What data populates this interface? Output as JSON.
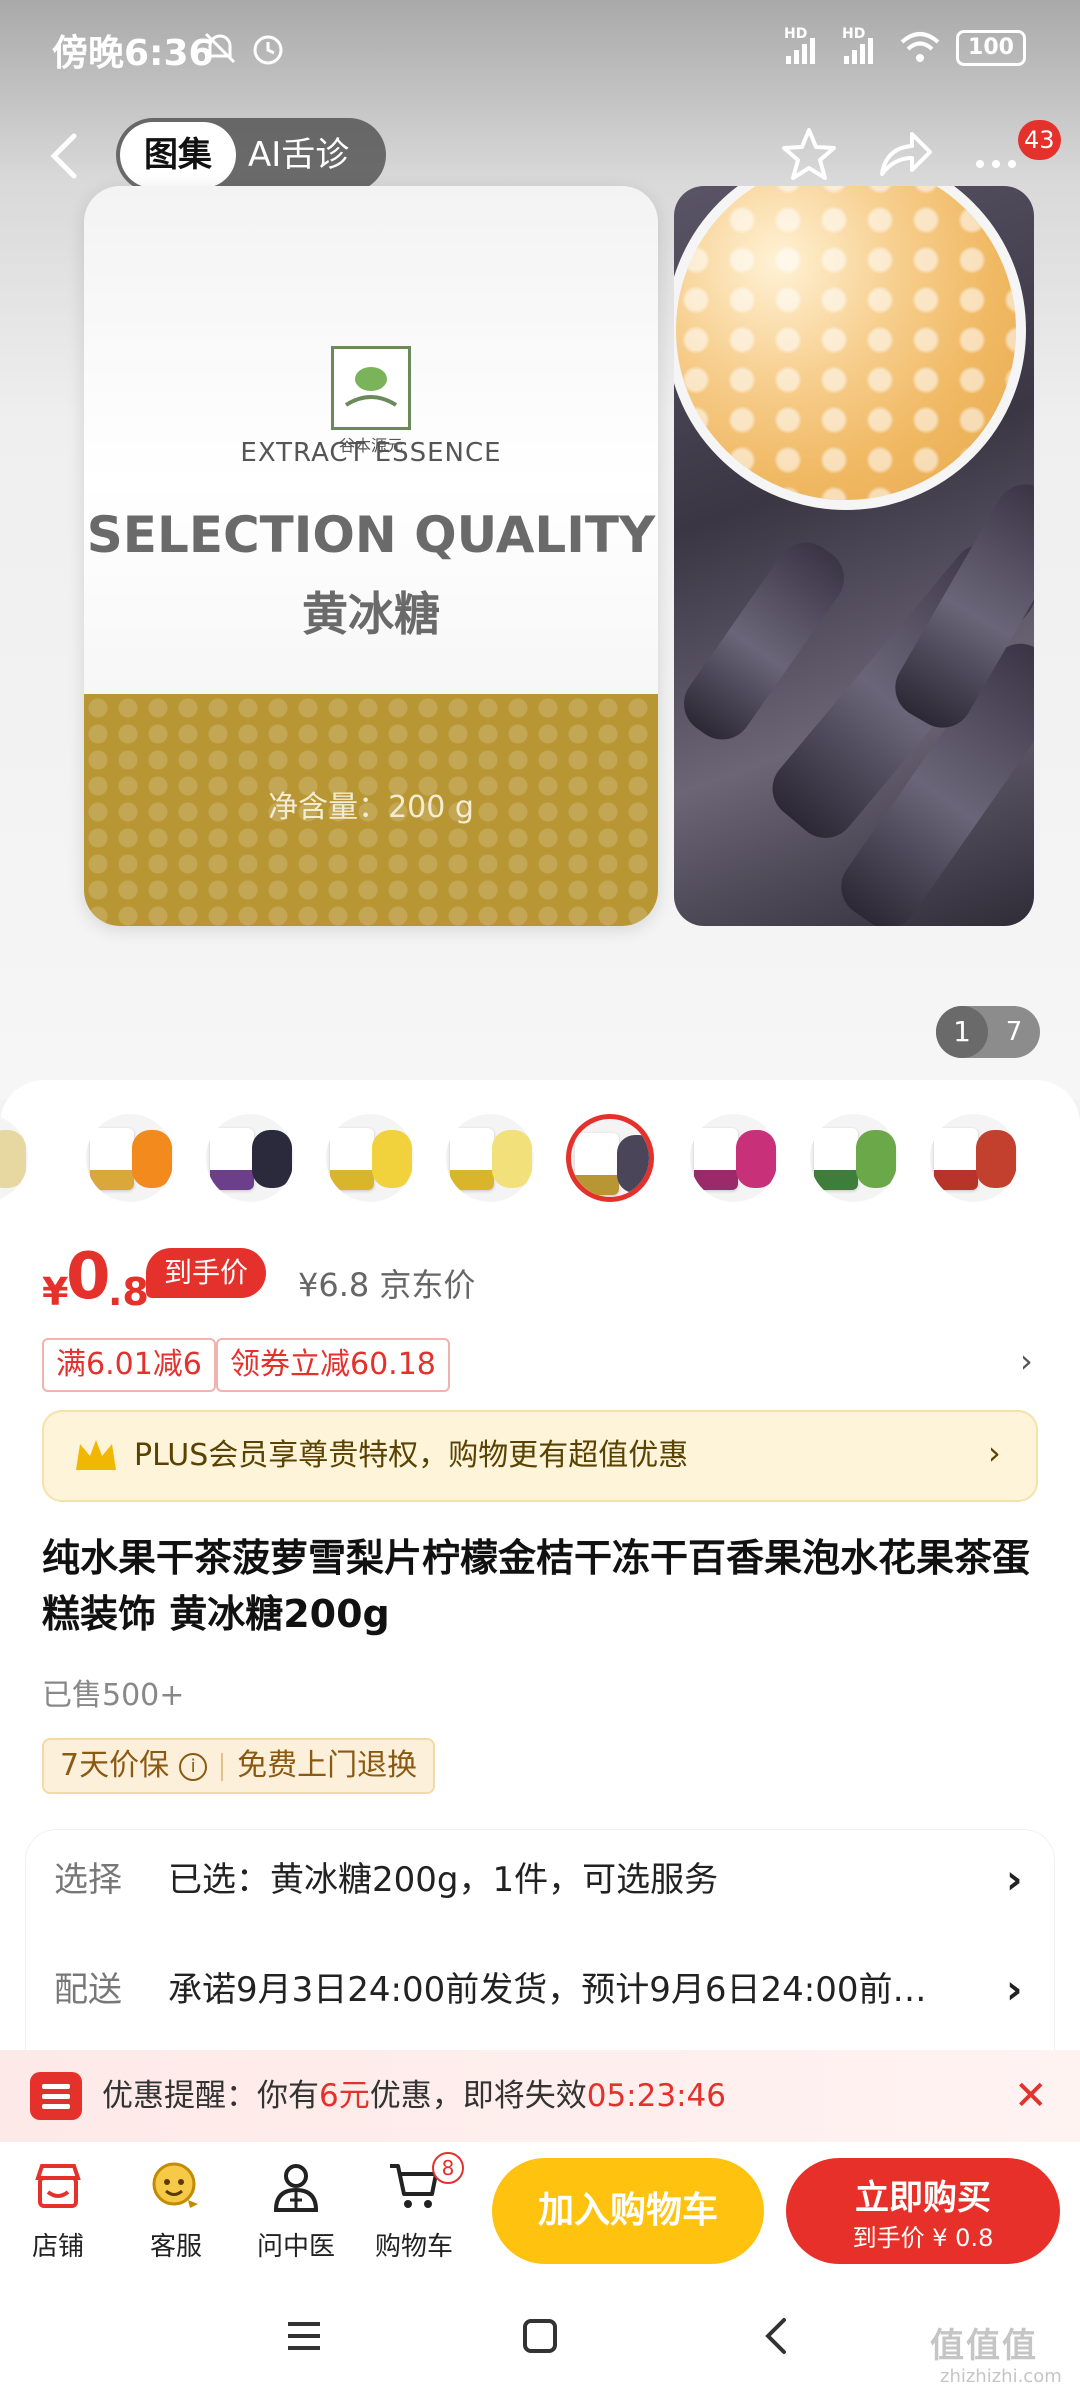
{
  "status": {
    "time": "傍晚6:36",
    "battery": "100",
    "signal1": "HD",
    "signal2": "HD"
  },
  "topbar": {
    "tab_gallery": "图集",
    "tab_ai": "AI舌诊",
    "more_badge": "43"
  },
  "gallery": {
    "pouch_brand": "谷本源元",
    "pouch_subtitle": "EXTRACT ESSENCE",
    "pouch_headline": "SELECTION QUALITY",
    "pouch_product": "黄冰糖",
    "pouch_net": "净含量：200 g",
    "page_current": "1",
    "page_total": "7"
  },
  "price": {
    "currency": "¥",
    "integer": "0",
    "decimal": ".8",
    "final_tag": "到手价",
    "jd_price": "¥6.8 京东价"
  },
  "coupons": [
    "满6.01减6",
    "领券立减60.18"
  ],
  "plus_banner": "PLUS会员享尊贵特权，购物更有超值优惠",
  "product": {
    "title": "纯水果干茶菠萝雪梨片柠檬金桔干冻干百香果泡水花果茶蛋糕装饰 黄冰糖200g",
    "sold": "已售500+",
    "guarantee_left": "7天价保",
    "guarantee_right": "免费上门退换"
  },
  "options": {
    "select_key": "选择",
    "select_val": "已选：黄冰糖200g，1件，可选服务",
    "delivery_key": "配送",
    "delivery_val": "承诺9月3日24:00前发货，预计9月6日24:00前…"
  },
  "reminder": {
    "prefix": "优惠提醒：你有",
    "amount": "6元",
    "middle": "优惠，即将失效",
    "countdown": "05:23:46"
  },
  "bottombar": {
    "store": "店铺",
    "service": "客服",
    "doctor": "问中医",
    "cart": "购物车",
    "cart_count": "8",
    "add_cart": "加入购物车",
    "buy_now": "立即购买",
    "buy_sub": "到手价 ¥ 0.8"
  },
  "watermark": {
    "main": "值值值",
    "sub": "zhizhizhi.com"
  },
  "colors": {
    "accent_red": "#e4312b",
    "cart_yellow": "#ffc20e",
    "plus_bg": "#fdf4da"
  }
}
